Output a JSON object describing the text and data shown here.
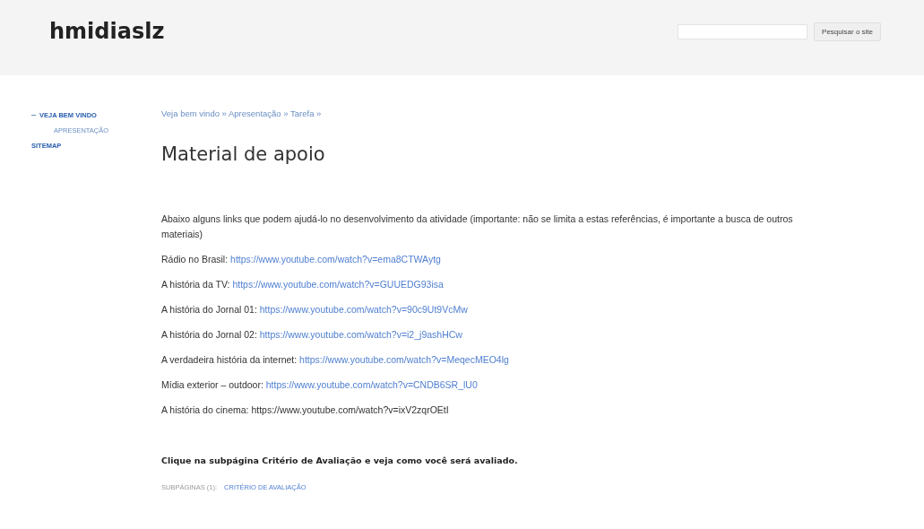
{
  "header": {
    "site_title": "hmidiaslz",
    "search_button": "Pesquisar o site"
  },
  "sidebar": {
    "items": [
      {
        "label": "VEJA BEM VINDO",
        "expanded": true,
        "children": [
          {
            "label": "APRESENTAÇÃO"
          }
        ]
      },
      {
        "label": "SITEMAP"
      }
    ]
  },
  "breadcrumb": "Veja bem vindo » Apresentação » Tarefa »",
  "page_title": "Material de apoio",
  "intro": "Abaixo alguns links que podem ajudá-lo no desenvolvimento da atividade (importante: não se limita a estas referências, é importante a busca de outros materiais)",
  "links": [
    {
      "label": "Rádio no Brasil:",
      "url": "https://www.youtube.com/watch?v=ema8CTWAytg",
      "linked": true
    },
    {
      "label": "A história da TV:",
      "url": "https://www.youtube.com/watch?v=GUUEDG93isa",
      "linked": true
    },
    {
      "label": "A história do Jornal 01:",
      "url": "https://www.youtube.com/watch?v=90c9Ut9VcMw",
      "linked": true
    },
    {
      "label": "A história do Jornal 02:",
      "url": "https://www.youtube.com/watch?v=i2_j9ashHCw",
      "linked": true
    },
    {
      "label": "A verdadeira história da internet:",
      "url": "https://www.youtube.com/watch?v=MeqecMEO4lg",
      "linked": true
    },
    {
      "label": "Mídia exterior – outdoor:",
      "url": "https://www.youtube.com/watch?v=CNDB6SR_lU0",
      "linked": true
    },
    {
      "label": "A história do cinema:",
      "url": "https://www.youtube.com/watch?v=ixV2zqrOEtI",
      "linked": false
    }
  ],
  "note": "Clique na subpágina Critério de Avaliação e veja como você será avaliado.",
  "subpages": {
    "label": "SUBPÁGINAS (1):",
    "items": [
      "CRITÉRIO DE AVALIAÇÃO"
    ]
  }
}
